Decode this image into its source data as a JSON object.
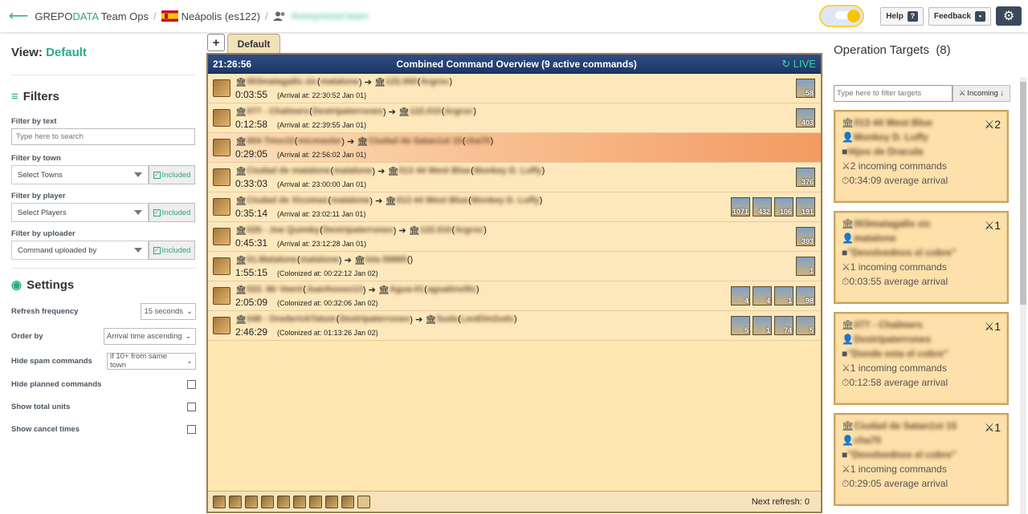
{
  "header": {
    "brand_a": "GREPO",
    "brand_b": "DATA",
    "brand_c": " Team Ops",
    "world": "Neápolis (es122)",
    "team_name": "Anonymized team",
    "help_label": "Help",
    "feedback_label": "Feedback"
  },
  "sidebar": {
    "view_label": "View:",
    "view_value": "Default",
    "filters_title": "Filters",
    "filter_text_label": "Filter by text",
    "filter_text_placeholder": "Type here to search",
    "filter_town_label": "Filter by town",
    "filter_town_value": "Select Towns",
    "filter_player_label": "Filter by player",
    "filter_player_value": "Select Players",
    "filter_uploader_label": "Filter by uploader",
    "filter_uploader_value": "Command uploaded by",
    "included_label": "Included",
    "settings_title": "Settings",
    "refresh_label": "Refresh frequency",
    "refresh_value": "15 seconds",
    "order_label": "Order by",
    "order_value": "Arrival time ascending",
    "spam_label": "Hide spam commands",
    "spam_value": "if 10+ from same town",
    "planned_label": "Hide planned commands",
    "total_label": "Show total units",
    "cancel_label": "Show cancel times"
  },
  "tabs": {
    "active": "Default"
  },
  "overview": {
    "clock": "21:26:56",
    "title": "Combined Command Overview  (9 active commands)",
    "live": "LIVE",
    "next_refresh": "Next refresh: 0",
    "rows": [
      {
        "src": "003matagallo xic",
        "src_player": "matalone",
        "dst": "122.000",
        "dst_player": "Argroc",
        "time": "0:03:55",
        "arrival": "(Arrival at: 22:30:52 Jan 01)",
        "units": [
          "58"
        ]
      },
      {
        "src": "077 - Chalmers",
        "src_player": "Destripaterrones",
        "dst": "122.010",
        "dst_player": "Argroc",
        "time": "0:12:58",
        "arrival": "(Arrival at: 22:39:55 Jan 01)",
        "units": [
          "403"
        ]
      },
      {
        "src": "004 Timo10",
        "src_player": "micmaster",
        "dst": "Ciudad de Satan1st 15",
        "dst_player": "cha70",
        "time": "0:29:05",
        "arrival": "(Arrival at: 22:56:02 Jan 01)",
        "units": []
      },
      {
        "src": "Ciudad de matalone",
        "src_player": "matalone",
        "dst": "013 44 West Blue",
        "dst_player": "Monkey D. Luffy",
        "time": "0:33:03",
        "arrival": "(Arrival at: 23:00:00 Jan 01)",
        "units": [
          "376"
        ]
      },
      {
        "src": "Ciudad de Xicomas",
        "src_player": "matalone",
        "dst": "013 44 West Blue",
        "dst_player": "Monkey D. Luffy",
        "time": "0:35:14",
        "arrival": "(Arrival at: 23:02:11 Jan 01)",
        "units": [
          "1071",
          "432",
          "106",
          "191"
        ]
      },
      {
        "src": "026 - Joe Quimby",
        "src_player": "Destripaterrones",
        "dst": "122.010",
        "dst_player": "Argroc",
        "time": "0:45:31",
        "arrival": "(Arrival at: 23:12:28 Jan 01)",
        "units": [
          "393"
        ]
      },
      {
        "src": "01.Matalone",
        "src_player": "matalone",
        "dst": "Isla 59880",
        "dst_player": "",
        "time": "1:55:15",
        "arrival": "(Colonized at: 00:22:12 Jan 02)",
        "units": [
          "1"
        ]
      },
      {
        "src": "022. Mr Veent",
        "src_player": "Juanhooso13",
        "dst": "Agua-01",
        "dst_player": "aguatinvillo",
        "time": "2:05:09",
        "arrival": "(Colonized at: 00:32:06 Jan 02)",
        "units": [
          "4",
          "4",
          "1",
          "98"
        ]
      },
      {
        "src": "048 - OrederickTatum",
        "src_player": "Destripaterrones",
        "dst": "Suda",
        "dst_player": "LeoElm2udo",
        "time": "2:46:29",
        "arrival": "(Colonized at: 01:13:26 Jan 02)",
        "units": [
          "5",
          "1",
          "74",
          "5"
        ]
      }
    ]
  },
  "targets": {
    "title": "Operation Targets",
    "count": "(8)",
    "filter_placeholder": "Type here to filter targets",
    "sort_label": "Incoming ↓",
    "cards": [
      {
        "town": "013 44 West Blue",
        "count": "2",
        "player": "Monkey D. Luffy",
        "alliance": "Hijos de Dracula",
        "incoming": "2 incoming commands",
        "avg": "0:34:09 average arrival"
      },
      {
        "town": "003matagallo xic",
        "count": "1",
        "player": "matalone",
        "alliance": "\"Devolvednos el cobre\"",
        "incoming": "1 incoming commands",
        "avg": "0:03:55 average arrival"
      },
      {
        "town": "077 - Chalmers",
        "count": "1",
        "player": "Destripaterrones",
        "alliance": "\"Donde esta el cobre\"",
        "incoming": "1 incoming commands",
        "avg": "0:12:58 average arrival"
      },
      {
        "town": "Ciudad de Satan1st 15",
        "count": "1",
        "player": "cha70",
        "alliance": "\"Devolvednos el cobre\"",
        "incoming": "1 incoming commands",
        "avg": "0:29:05 average arrival"
      }
    ]
  }
}
